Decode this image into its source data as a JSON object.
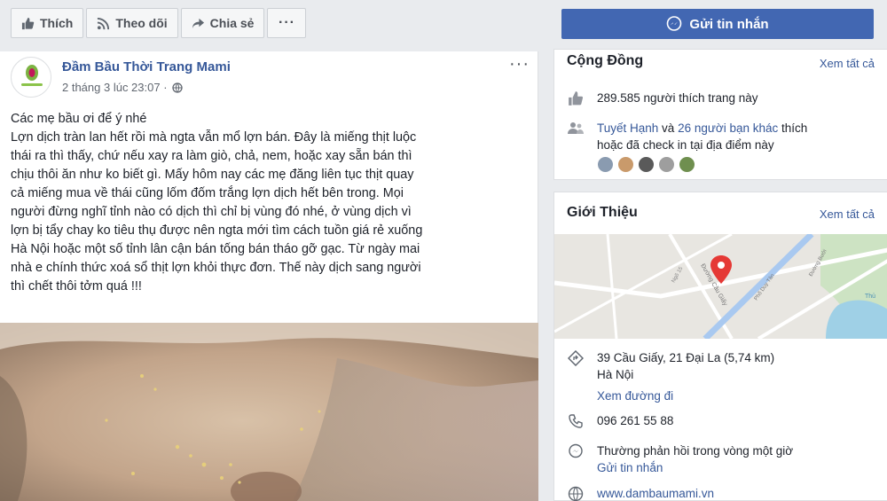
{
  "toolbar": {
    "like_label": "Thích",
    "follow_label": "Theo dõi",
    "share_label": "Chia sẻ",
    "more_label": "···",
    "send_message_label": "Gửi tin nhắn"
  },
  "post": {
    "page_name": "Đầm Bầu Thời Trang Mami",
    "timestamp": "2 tháng 3 lúc 23:07 ·",
    "more_label": "···",
    "text_lines": [
      "Các mẹ bầu ơi để ý nhé",
      "Lợn dịch tràn lan hết rồi mà ngta vẫn mổ lợn bán. Đây là miếng thịt luộc",
      "thái ra thì thấy, chứ nếu xay ra làm giò, chả, nem, hoặc xay sẵn bán thì",
      "chịu thôi ăn như ko biết gì. Mấy hôm nay các mẹ đăng liên tục thịt quay",
      "cả miếng mua về thái cũng lốm đốm trắng lợn dịch hết bên trong. Mọi",
      "người đừng nghĩ tỉnh nào có dịch thì chỉ bị vùng đó nhé, ở vùng dịch vì",
      "lợn bị tẩy chay ko tiêu thụ được nên ngta mới tìm cách tuồn giá rẻ xuống",
      "Hà Nội hoặc một số tỉnh lân cận bán tống bán tháo gỡ gạc. Từ ngày mai",
      "nhà e chính thức xoá sổ thịt lợn khỏi thực đơn. Thế này dịch sang người",
      "thì chết thôi tởm quá !!!"
    ]
  },
  "community": {
    "title": "Cộng Đồng",
    "see_all": "Xem tất cả",
    "likes_text": "289.585 người thích trang này",
    "friend_name": "Tuyết Hạnh",
    "and_text": " và ",
    "friends_count": "26 người bạn khác",
    "friends_suffix": " thích",
    "friends_line2": "hoặc đã check in tại địa điểm này",
    "friend_colors": [
      "#8a9bb0",
      "#c99a6b",
      "#5a5a5a",
      "#9e9e9e",
      "#6f8f4f"
    ]
  },
  "about": {
    "title": "Giới Thiệu",
    "see_all": "Xem tất cả",
    "map_labels": [
      "Đường Cầu Giấy",
      "Ngõ 15",
      "Phố Duy Tân",
      "Đường Bưởi",
      "Thủ"
    ],
    "address_line1": "39 Cầu Giấy, 21 Đại La (5,74 km)",
    "address_line2": "Hà Nội",
    "directions": "Xem đường đi",
    "phone": "096 261 55 88",
    "response_text": "Thường phản hồi trong vòng một giờ",
    "send_message": "Gửi tin nhắn",
    "website": "www.dambaumami.vn"
  },
  "colors": {
    "brand_blue": "#4267b2",
    "link_blue": "#365899",
    "map_pin": "#e53935"
  }
}
